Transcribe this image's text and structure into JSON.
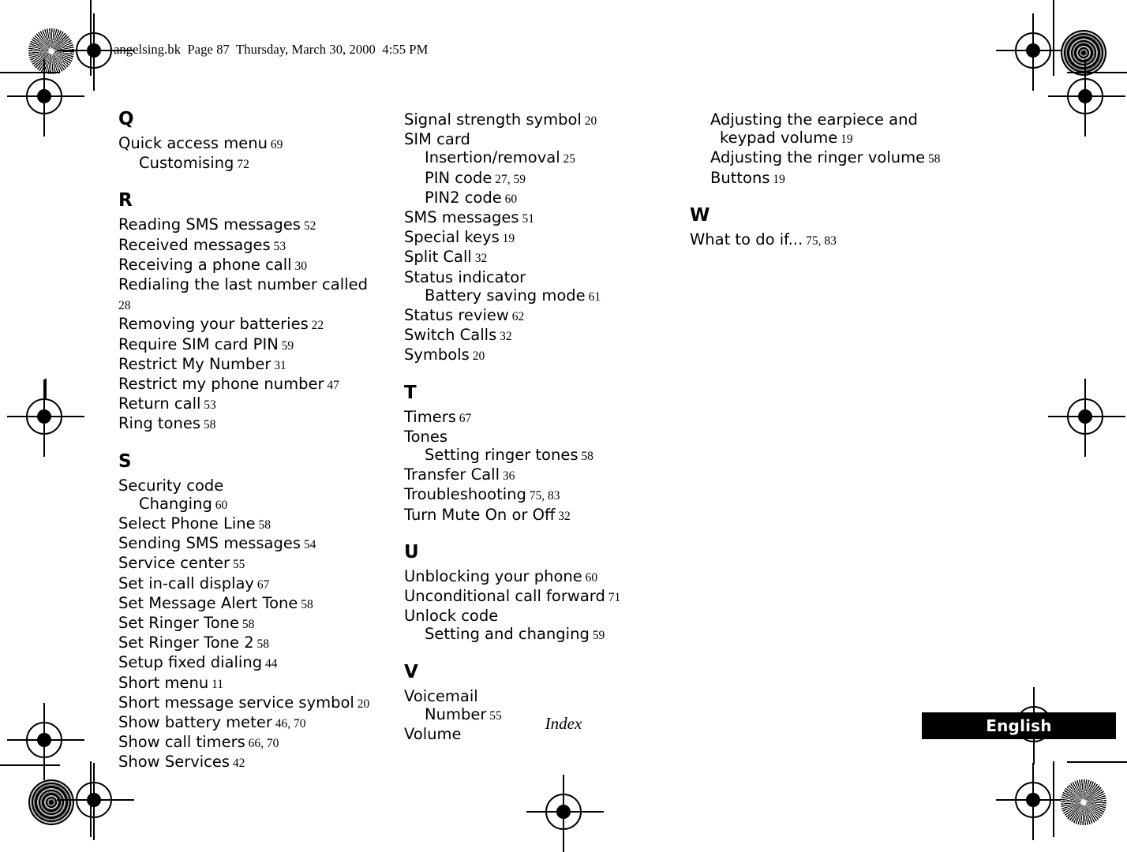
{
  "header": {
    "slug": "angelsing.bk  Page 87  Thursday, March 30, 2000  4:55 PM"
  },
  "footer": {
    "folio": "Index",
    "language_tab": "English"
  },
  "index": {
    "columns": [
      {
        "sections": [
          {
            "letter": "Q",
            "entries": [
              {
                "text": "Quick access menu",
                "pages": "69",
                "level": 0
              },
              {
                "text": "Customising",
                "pages": "72",
                "level": 1
              }
            ]
          },
          {
            "letter": "R",
            "entries": [
              {
                "text": "Reading SMS messages",
                "pages": "52",
                "level": 0
              },
              {
                "text": "Received messages",
                "pages": "53",
                "level": 0
              },
              {
                "text": "Receiving a phone call",
                "pages": "30",
                "level": 0
              },
              {
                "text": "Redialing the last number called",
                "pages": "28",
                "level": 0
              },
              {
                "text": "Removing your batteries",
                "pages": "22",
                "level": 0
              },
              {
                "text": "Require SIM card PIN",
                "pages": "59",
                "level": 0
              },
              {
                "text": "Restrict My Number",
                "pages": "31",
                "level": 0
              },
              {
                "text": "Restrict my phone number",
                "pages": "47",
                "level": 0
              },
              {
                "text": "Return call",
                "pages": "53",
                "level": 0
              },
              {
                "text": "Ring tones",
                "pages": "58",
                "level": 0
              }
            ]
          },
          {
            "letter": "S",
            "entries": [
              {
                "text": "Security code",
                "pages": "",
                "level": 0
              },
              {
                "text": "Changing",
                "pages": "60",
                "level": 1
              },
              {
                "text": "Select Phone Line",
                "pages": "58",
                "level": 0
              },
              {
                "text": "Sending SMS messages",
                "pages": "54",
                "level": 0
              },
              {
                "text": "Service center",
                "pages": "55",
                "level": 0
              },
              {
                "text": "Set in-call display",
                "pages": "67",
                "level": 0
              },
              {
                "text": "Set Message Alert Tone",
                "pages": "58",
                "level": 0
              },
              {
                "text": "Set Ringer Tone",
                "pages": "58",
                "level": 0
              },
              {
                "text": "Set Ringer Tone 2",
                "pages": "58",
                "level": 0
              },
              {
                "text": "Setup fixed dialing",
                "pages": "44",
                "level": 0
              },
              {
                "text": "Short menu",
                "pages": "11",
                "level": 0
              },
              {
                "text": "Short message service symbol",
                "pages": "20",
                "level": 0
              },
              {
                "text": "Show battery meter",
                "pages": "46, 70",
                "level": 0
              },
              {
                "text": "Show call timers",
                "pages": "66, 70",
                "level": 0
              },
              {
                "text": "Show Services",
                "pages": "42",
                "level": 0
              }
            ]
          }
        ]
      },
      {
        "sections": [
          {
            "letter": "",
            "entries": [
              {
                "text": "Signal strength symbol",
                "pages": "20",
                "level": 0
              },
              {
                "text": "SIM card",
                "pages": "",
                "level": 0
              },
              {
                "text": "Insertion/removal",
                "pages": "25",
                "level": 1
              },
              {
                "text": "PIN code",
                "pages": "27, 59",
                "level": 1
              },
              {
                "text": "PIN2 code",
                "pages": "60",
                "level": 1
              },
              {
                "text": "SMS messages",
                "pages": "51",
                "level": 0
              },
              {
                "text": "Special keys",
                "pages": "19",
                "level": 0
              },
              {
                "text": "Split Call",
                "pages": "32",
                "level": 0
              },
              {
                "text": "Status indicator",
                "pages": "",
                "level": 0
              },
              {
                "text": "Battery saving mode",
                "pages": "61",
                "level": 1
              },
              {
                "text": "Status review",
                "pages": "62",
                "level": 0
              },
              {
                "text": "Switch Calls",
                "pages": "32",
                "level": 0
              },
              {
                "text": "Symbols",
                "pages": "20",
                "level": 0
              }
            ]
          },
          {
            "letter": "T",
            "entries": [
              {
                "text": "Timers",
                "pages": "67",
                "level": 0
              },
              {
                "text": "Tones",
                "pages": "",
                "level": 0
              },
              {
                "text": "Setting ringer tones",
                "pages": "58",
                "level": 1
              },
              {
                "text": "Transfer Call",
                "pages": "36",
                "level": 0
              },
              {
                "text": "Troubleshooting",
                "pages": "75, 83",
                "level": 0
              },
              {
                "text": "Turn Mute On or Off",
                "pages": "32",
                "level": 0
              }
            ]
          },
          {
            "letter": "U",
            "entries": [
              {
                "text": "Unblocking your phone",
                "pages": "60",
                "level": 0
              },
              {
                "text": "Unconditional call forward",
                "pages": "71",
                "level": 0
              },
              {
                "text": "Unlock code",
                "pages": "",
                "level": 0
              },
              {
                "text": "Setting and changing",
                "pages": "59",
                "level": 1
              }
            ]
          },
          {
            "letter": "V",
            "entries": [
              {
                "text": "Voicemail",
                "pages": "",
                "level": 0
              },
              {
                "text": "Number",
                "pages": "55",
                "level": 1
              },
              {
                "text": "Volume",
                "pages": "",
                "level": 0
              }
            ]
          }
        ]
      },
      {
        "sections": [
          {
            "letter": "",
            "entries": [
              {
                "text": "Adjusting the earpiece and keypad volume",
                "pages": "19",
                "level": 1
              },
              {
                "text": "Adjusting the ringer volume",
                "pages": "58",
                "level": 1
              },
              {
                "text": "Buttons",
                "pages": "19",
                "level": 1
              }
            ]
          },
          {
            "letter": "W",
            "entries": [
              {
                "text": "What to do if...",
                "pages": "75, 83",
                "level": 0
              }
            ]
          }
        ]
      }
    ]
  }
}
